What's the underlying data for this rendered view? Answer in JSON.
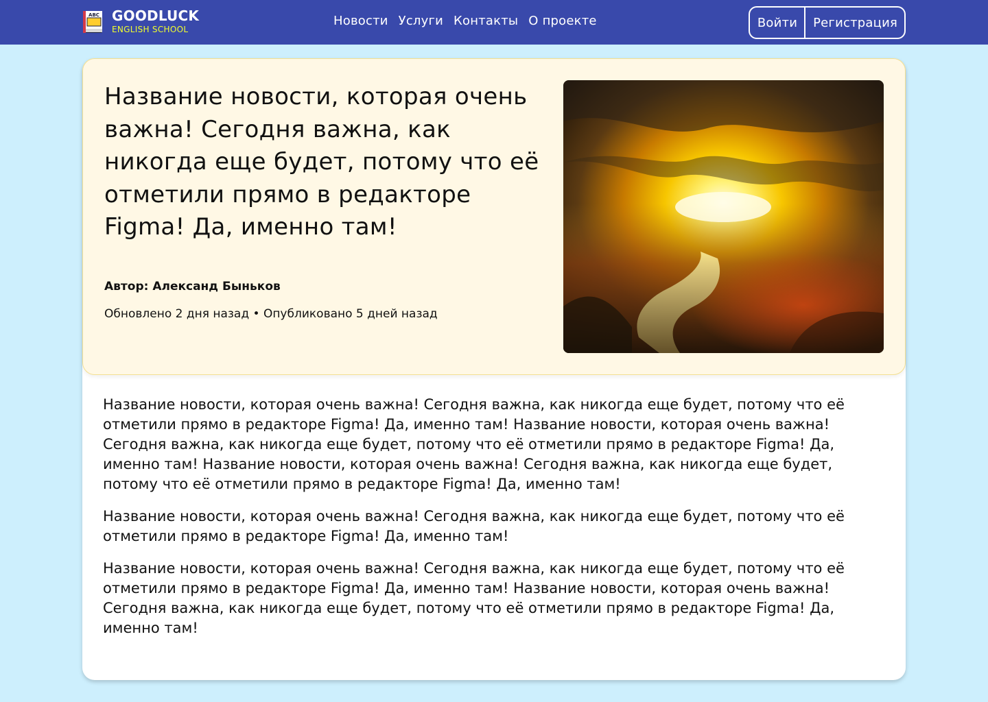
{
  "header": {
    "logo_title": "GOODLUCK",
    "logo_subtitle": "ENGLISH SCHOOL",
    "logo_icon": "abc-book-icon",
    "nav": [
      "Новости",
      "Услуги",
      "Контакты",
      "О проекте"
    ],
    "login_label": "Войти",
    "register_label": "Регистрация",
    "colors": {
      "header_bg": "#3949ab",
      "logo_subtitle": "#f1ff2c",
      "page_bg": "#cdeffd",
      "hero_bg": "#fff8e5",
      "hero_border": "#f3df90"
    }
  },
  "hero": {
    "title": "Название новости, которая очень важна! Сегодня важна, как никогда еще будет, потому что её отметили прямо в редакторе Figma! Да, именно там!",
    "author": "Автор: Александ Быньков",
    "meta": "Обновлено 2 дня назад • Опубликовано 5 дней назад",
    "image_description": "sunset-landscape-image"
  },
  "article": {
    "paragraphs": [
      "Название новости, которая очень важна! Сегодня важна, как никогда еще будет, потому что её отметили прямо в редакторе Figma! Да, именно там! Название новости, которая очень важна! Сегодня важна, как никогда еще будет, потому что её отметили прямо в редакторе Figma! Да, именно там! Название новости, которая очень важна! Сегодня важна, как никогда еще будет, потому что её отметили прямо в редакторе Figma! Да, именно там!",
      "Название новости, которая очень важна! Сегодня важна, как никогда еще будет, потому что её отметили прямо в редакторе Figma! Да, именно там!",
      "Название новости, которая очень важна! Сегодня важна, как никогда еще будет, потому что её отметили прямо в редакторе Figma! Да, именно там! Название новости, которая очень важна! Сегодня важна, как никогда еще будет, потому что её отметили прямо в редакторе Figma! Да, именно там!"
    ]
  }
}
